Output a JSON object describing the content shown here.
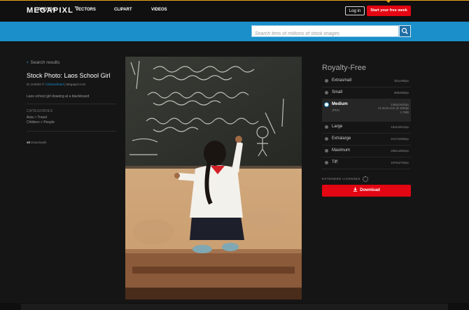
{
  "header": {
    "logo": "MEGAPIXL",
    "logo_tm": "™",
    "login_label": "Log in",
    "trial_label": "Start your free week"
  },
  "nav": {
    "items": [
      {
        "label": "PHOTOS"
      },
      {
        "label": "VECTORS"
      },
      {
        "label": "CLIPART"
      },
      {
        "label": "VIDEOS"
      }
    ],
    "search_placeholder": "Search tens of millions of stock images"
  },
  "sidebar": {
    "back_label": "Search results",
    "title": "Stock Photo: Laos School Girl",
    "id_prefix": "ID 104083 ©",
    "author": "Clickandread",
    "site": "| Megapixl.com",
    "description": "Laos school girl drawing at a blackboard",
    "categories_heading": "CATEGORIES",
    "categories": [
      "Asia > Travel",
      "Children > People"
    ],
    "downloads_count": "46",
    "downloads_label": "Downloads"
  },
  "pricing": {
    "title": "Royalty-Free",
    "sizes": [
      {
        "name": "Extrasmall",
        "dims": "351x480px"
      },
      {
        "name": "Small",
        "dims": "585x800px"
      },
      {
        "name": "Medium",
        "format": "JPEG",
        "dims": "1365x1920px",
        "print": "11.6x16.2cm @ 300dpi",
        "filesize": "1.7MB"
      },
      {
        "name": "Large",
        "dims": "1911x2613px"
      },
      {
        "name": "Extralarge",
        "dims": "2417x3300px"
      },
      {
        "name": "Maximum",
        "dims": "2961x4052px"
      },
      {
        "name": "Tiff",
        "dims": "1975x2700px"
      }
    ],
    "extended_label": "EXTENDED LICENSES",
    "download_label": "Download"
  },
  "photo": {
    "board_lines": [
      "1/. ...",
      "2/. ...",
      "3/. ..."
    ]
  },
  "colors": {
    "brand_red": "#e30613",
    "nav_blue": "#1a8fc9",
    "accent_orange": "#e6a21d"
  }
}
